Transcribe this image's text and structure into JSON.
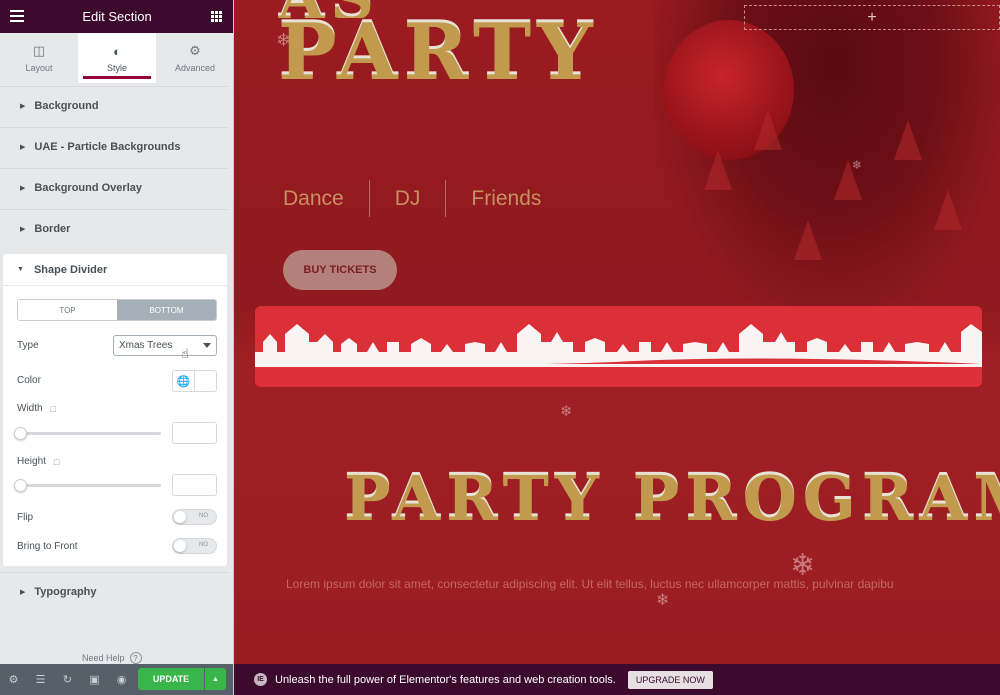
{
  "sidebar": {
    "header": {
      "title": "Edit Section"
    },
    "tabs": [
      {
        "label": "Layout",
        "icon": "layout-icon"
      },
      {
        "label": "Style",
        "icon": "contrast-icon"
      },
      {
        "label": "Advanced",
        "icon": "gear-icon"
      }
    ],
    "sections": [
      "Background",
      "UAE - Particle Backgrounds",
      "Background Overlay",
      "Border"
    ],
    "shape_divider": {
      "title": "Shape Divider",
      "toggle": [
        "TOP",
        "BOTTOM"
      ],
      "type_label": "Type",
      "type_value": "Xmas Trees",
      "color_label": "Color",
      "width_label": "Width",
      "height_label": "Height",
      "flip_label": "Flip",
      "flip_value": "NO",
      "front_label": "Bring to Front",
      "front_value": "NO"
    },
    "typography": "Typography",
    "need_help": "Need Help",
    "footer": {
      "update": "UPDATE"
    }
  },
  "canvas": {
    "title_line1": "AS",
    "title_line2": "PARTY",
    "nav": [
      "Dance",
      "DJ",
      "Friends"
    ],
    "buy": "BUY TICKETS",
    "program_title": "PARTY PROGRAM",
    "lorem": "Lorem ipsum dolor sit amet, consectetur adipiscing elit. Ut elit tellus, luctus nec ullamcorper mattis, pulvinar dapibu"
  },
  "promo": {
    "message": "Unleash the full power of Elementor's features and web creation tools.",
    "button": "UPGRADE NOW"
  },
  "colors": {
    "header_bg": "#3b0a2c",
    "accent": "#93003c",
    "update_green": "#39b54a",
    "canvas_red": "#9b1b20",
    "gold": "#c19a4d"
  }
}
